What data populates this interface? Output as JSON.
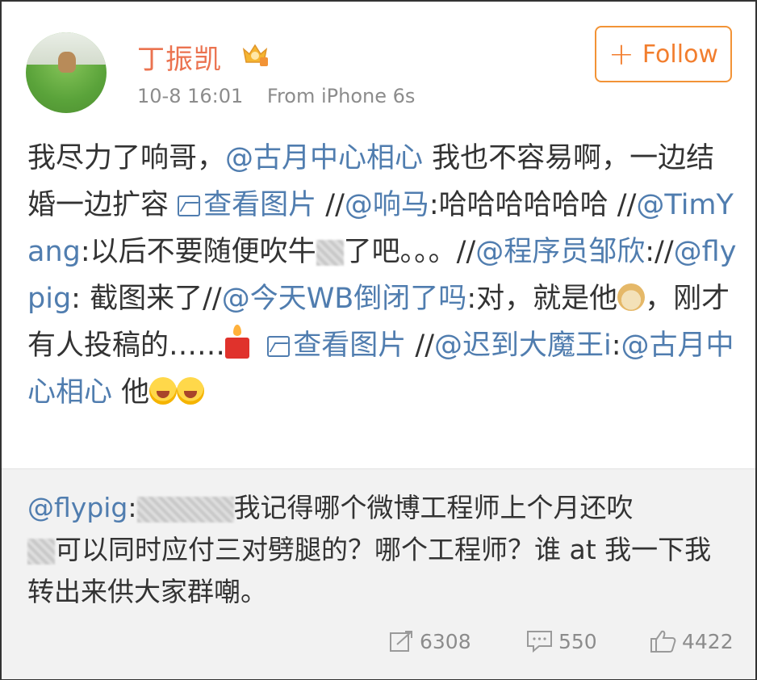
{
  "header": {
    "username": "丁振凯",
    "time": "10-8 16:01",
    "source": "From iPhone 6s",
    "follow_label": "Follow"
  },
  "post": {
    "seg1": "我尽力了响哥，",
    "mention1": "@古月中心相心",
    "seg2": " 我也不容易啊，一边结婚一边扩容 ",
    "view_pic": "查看图片",
    "seg3": " //",
    "mention2": "@响马",
    "seg4": ":哈哈哈哈哈哈 //",
    "mention3": "@TimYang",
    "seg5": ":以后不要随便吹牛",
    "seg6": "了吧。。。//",
    "mention4": "@程序员邹欣",
    "seg7": "://",
    "mention5": "@flypig",
    "seg8": ": 截图来了//",
    "mention6": "@今天WB倒闭了吗",
    "seg9": ":对，就是他",
    "seg10": "，刚才有人投稿的……",
    "view_pic2": "查看图片",
    "seg11": " //",
    "mention7": "@迟到大魔王i",
    "seg12": ":",
    "mention8": "@古月中心相心",
    "seg13": " 他"
  },
  "repost": {
    "mention": "@flypig",
    "seg1": ":",
    "seg2": "我记得哪个微博工程师上个月还吹",
    "seg3": "可以同时应付三对劈腿的？哪个工程师？谁 at 我一下我转出来供大家群嘲。"
  },
  "actions": {
    "repost_count": "6308",
    "comment_count": "550",
    "like_count": "4422"
  },
  "colors": {
    "username": "#eb7350",
    "link": "#507daf",
    "follow": "#f29336",
    "muted": "#8c8c8c"
  }
}
